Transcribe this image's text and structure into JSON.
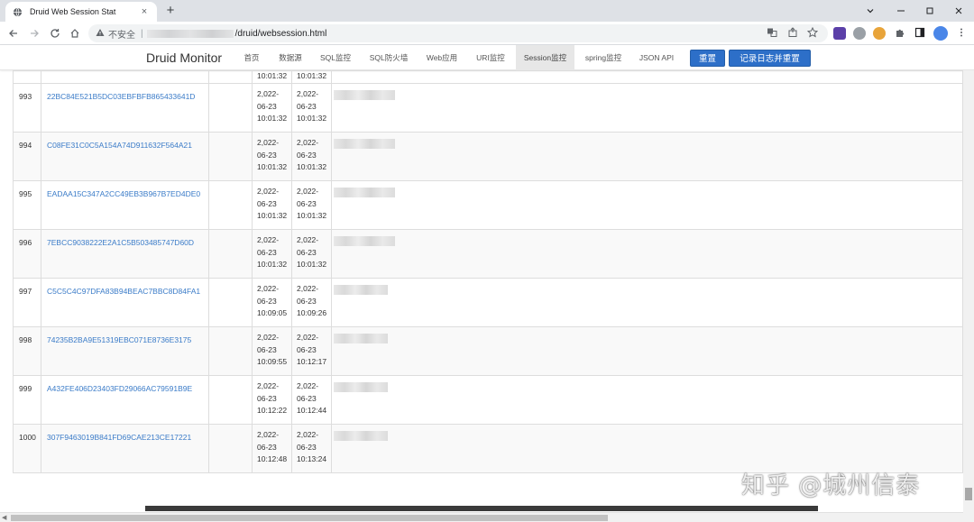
{
  "browser": {
    "tab_title": "Druid Web Session Stat",
    "tab_close": "×",
    "new_tab": "+",
    "insecure_label": "不安全",
    "url_separator": "|",
    "url_path": "/druid/websession.html"
  },
  "druid": {
    "brand": "Druid Monitor",
    "nav": [
      {
        "label": "首页"
      },
      {
        "label": "数据源"
      },
      {
        "label": "SQL监控"
      },
      {
        "label": "SQL防火墙"
      },
      {
        "label": "Web应用"
      },
      {
        "label": "URI监控"
      },
      {
        "label": "Session监控",
        "active": true
      },
      {
        "label": "spring监控"
      },
      {
        "label": "JSON API"
      }
    ],
    "reset_button": "重置",
    "log_reset_button": "记录日志并重置"
  },
  "table": {
    "partial_row": {
      "time1": "10:01:32",
      "time2": "10:01:32"
    },
    "rows": [
      {
        "id": "993",
        "session_id": "22BC84E521B5DC03EBFBFB865433641D",
        "t1": [
          "2,022-",
          "06-23",
          "10:01:32"
        ],
        "t2": [
          "2,022-",
          "06-23",
          "10:01:32"
        ]
      },
      {
        "id": "994",
        "session_id": "C08FE31C0C5A154A74D911632F564A21",
        "t1": [
          "2,022-",
          "06-23",
          "10:01:32"
        ],
        "t2": [
          "2,022-",
          "06-23",
          "10:01:32"
        ]
      },
      {
        "id": "995",
        "session_id": "EADAA15C347A2CC49EB3B967B7ED4DE0",
        "t1": [
          "2,022-",
          "06-23",
          "10:01:32"
        ],
        "t2": [
          "2,022-",
          "06-23",
          "10:01:32"
        ]
      },
      {
        "id": "996",
        "session_id": "7EBCC9038222E2A1C5B503485747D60D",
        "t1": [
          "2,022-",
          "06-23",
          "10:01:32"
        ],
        "t2": [
          "2,022-",
          "06-23",
          "10:01:32"
        ]
      },
      {
        "id": "997",
        "session_id": "C5C5C4C97DFA83B94BEAC7BBC8D84FA1",
        "t1": [
          "2,022-",
          "06-23",
          "10:09:05"
        ],
        "t2": [
          "2,022-",
          "06-23",
          "10:09:26"
        ]
      },
      {
        "id": "998",
        "session_id": "74235B2BA9E51319EBC071E8736E3175",
        "t1": [
          "2,022-",
          "06-23",
          "10:09:55"
        ],
        "t2": [
          "2,022-",
          "06-23",
          "10:12:17"
        ]
      },
      {
        "id": "999",
        "session_id": "A432FE406D23403FD29066AC79591B9E",
        "t1": [
          "2,022-",
          "06-23",
          "10:12:22"
        ],
        "t2": [
          "2,022-",
          "06-23",
          "10:12:44"
        ]
      },
      {
        "id": "1000",
        "session_id": "307F9463019B841FD69CAE213CE17221",
        "t1": [
          "2,022-",
          "06-23",
          "10:12:48"
        ],
        "t2": [
          "2,022-",
          "06-23",
          "10:13:24"
        ]
      }
    ]
  },
  "watermark": "知乎 @城州信泰",
  "colors": {
    "link": "#3a7bc8",
    "primary_button": "#2d6fc8",
    "active_nav": "#e7e7e7"
  },
  "icons": [
    "globe-icon",
    "back-icon",
    "forward-icon",
    "reload-icon",
    "home-icon",
    "warning-icon",
    "translate-icon",
    "share-icon",
    "star-icon",
    "extension-puzzle-icon",
    "side-panel-icon",
    "profile-avatar-icon"
  ]
}
